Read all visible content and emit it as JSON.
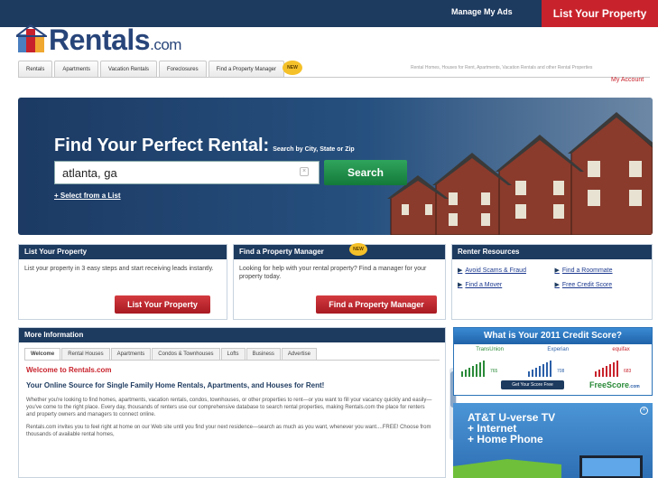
{
  "topbar": {
    "manage_ads": "Manage My Ads",
    "list_property": "List Your Property"
  },
  "brand": {
    "name": "Rentals",
    "domain": ".com"
  },
  "nav": {
    "tabs": [
      "Rentals",
      "Apartments",
      "Vacation Rentals",
      "Foreclosures",
      "Find a Property Manager"
    ],
    "new_badge": "NEW",
    "tagline": "Rental Homes, Houses for Rent, Apartments, Vacation Rentals and other Rental Properties",
    "my_account": "My Account"
  },
  "hero": {
    "title": "Find Your Perfect Rental:",
    "subtitle": "Search by City, State or Zip",
    "search_value": "atlanta, ga",
    "search_button": "Search",
    "select_list": "+ Select from a List"
  },
  "list_property_panel": {
    "title": "List Your Property",
    "text": "List your property in 3 easy steps and start receiving leads instantly.",
    "button": "List Your Property"
  },
  "property_manager_panel": {
    "title": "Find a Property Manager",
    "badge": "NEW",
    "text": "Looking for help with your rental property? Find a manager for your property today.",
    "button": "Find a Property Manager"
  },
  "renter_resources": {
    "title": "Renter Resources",
    "links": [
      "Avoid Scams & Fraud",
      "Find a Roommate",
      "Find a Mover",
      "Free Credit Score"
    ]
  },
  "more_info": {
    "title": "More Information",
    "tabs": [
      "Welcome",
      "Rental Houses",
      "Apartments",
      "Condos & Townhouses",
      "Lofts",
      "Business",
      "Advertise"
    ],
    "welcome_heading": "Welcome to Rentals.com",
    "subheading": "Your Online Source for Single Family Home Rentals, Apartments, and Houses for Rent!",
    "paragraph1": "Whether you're looking to find homes, apartments, vacation rentals, condos, townhouses, or other properties to rent—or you want to fill your vacancy quickly and easily—you've come to the right place. Every day, thousands of renters use our comprehensive database to search rental properties, making Rentals.com the place for renters and property owners and managers to connect online.",
    "paragraph2": "Rentals.com invites you to feel right at home on our Web site until you find your next residence—search as much as you want, whenever you want....FREE! Choose from thousands of available rental homes,"
  },
  "ad_credit": {
    "headline": "What is Your 2011 Credit Score?",
    "bureaus": [
      "TransUnion",
      "Experian",
      "equifax"
    ],
    "scores": [
      "765",
      "708",
      "683"
    ],
    "button": "Get Your Score Free",
    "logo_main": "FreeScore",
    "logo_suffix": ".com"
  },
  "ad_att": {
    "lines": [
      "AT&T U-verse TV",
      "+ Internet",
      "+ Home Phone"
    ]
  },
  "colors": {
    "navy": "#1d3a5f",
    "red": "#c8232c",
    "green": "#1f8a47",
    "link": "#1d3a8f"
  }
}
